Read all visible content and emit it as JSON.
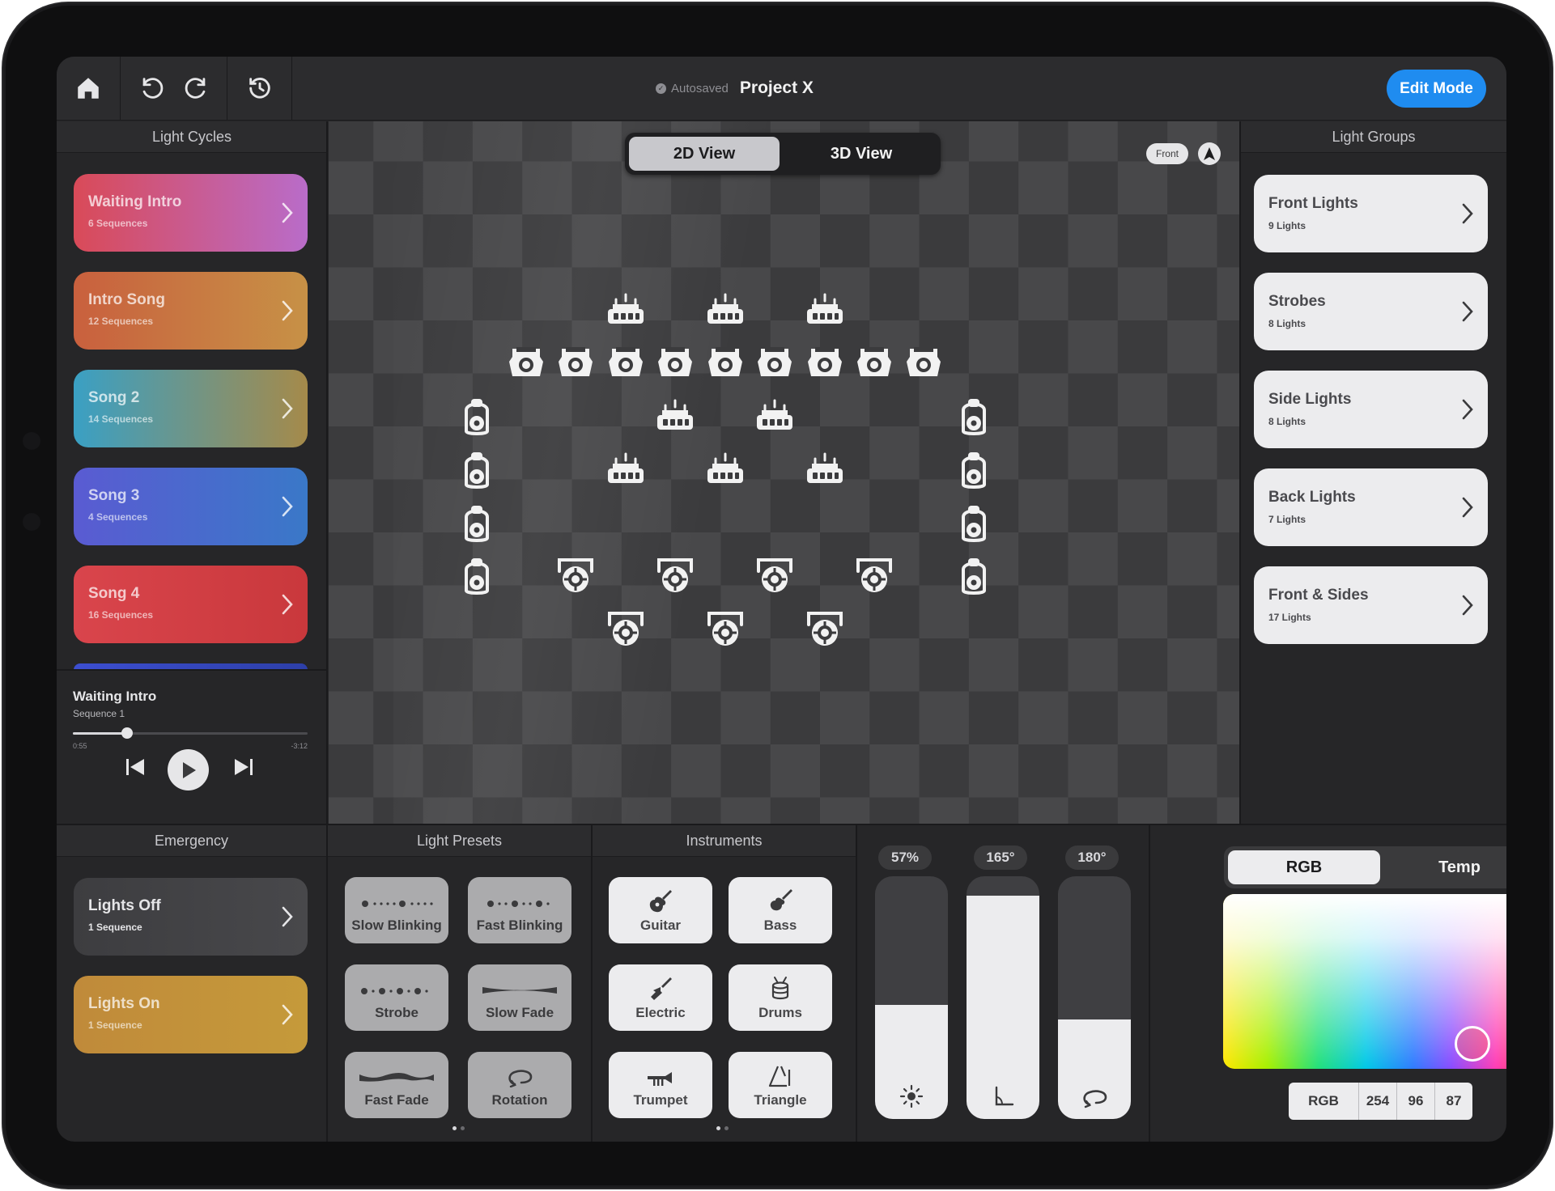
{
  "app": {
    "autosaved": "Autosaved",
    "project_title": "Project X",
    "edit_mode_label": "Edit Mode"
  },
  "light_cycles": {
    "header": "Light Cycles",
    "items": [
      {
        "title": "Waiting Intro",
        "subtitle": "6 Sequences",
        "gradient": [
          "#d94a58",
          "#b96cc9"
        ]
      },
      {
        "title": "Intro Song",
        "subtitle": "12 Sequences",
        "gradient": [
          "#c9603e",
          "#c79146"
        ]
      },
      {
        "title": "Song 2",
        "subtitle": "14 Sequences",
        "gradient": [
          "#3aa0c4",
          "#a58a4a"
        ]
      },
      {
        "title": "Song 3",
        "subtitle": "4 Sequences",
        "gradient": [
          "#5a5bd2",
          "#3a78c8"
        ]
      },
      {
        "title": "Song 4",
        "subtitle": "16 Sequences",
        "gradient": [
          "#d9454c",
          "#c9383c"
        ]
      }
    ]
  },
  "player": {
    "title": "Waiting Intro",
    "subtitle": "Sequence 1",
    "elapsed": "0:55",
    "remaining": "-3:12",
    "progress": 0.23
  },
  "stage": {
    "view_options": [
      "2D View",
      "3D View"
    ],
    "selected_view": "2D View",
    "orientation_label": "Front"
  },
  "light_groups": {
    "header": "Light Groups",
    "items": [
      {
        "title": "Front Lights",
        "subtitle": "9 Lights"
      },
      {
        "title": "Strobes",
        "subtitle": "8 Lights"
      },
      {
        "title": "Side Lights",
        "subtitle": "8 Lights"
      },
      {
        "title": "Back Lights",
        "subtitle": "7 Lights"
      },
      {
        "title": "Front & Sides",
        "subtitle": "17 Lights"
      }
    ]
  },
  "emergency": {
    "header": "Emergency",
    "items": [
      {
        "title": "Lights Off",
        "subtitle": "1 Sequence"
      },
      {
        "title": "Lights On",
        "subtitle": "1 Sequence"
      }
    ]
  },
  "presets": {
    "header": "Light Presets",
    "items": [
      "Slow Blinking",
      "Fast Blinking",
      "Strobe",
      "Slow Fade",
      "Fast Fade",
      "Rotation"
    ]
  },
  "instruments": {
    "header": "Instruments",
    "items": [
      "Guitar",
      "Bass",
      "Electric",
      "Drums",
      "Trumpet",
      "Triangle"
    ]
  },
  "sliders": [
    {
      "label": "57%",
      "level": 0.47,
      "icon": "brightness-icon"
    },
    {
      "label": "165°",
      "level": 0.92,
      "icon": "angle-icon"
    },
    {
      "label": "180°",
      "level": 0.41,
      "icon": "rotation-icon"
    }
  ],
  "color": {
    "tabs": [
      "RGB",
      "Temp"
    ],
    "selected_tab": "RGB",
    "mode_label": "RGB",
    "r": "254",
    "g": "96",
    "b": "87"
  }
}
